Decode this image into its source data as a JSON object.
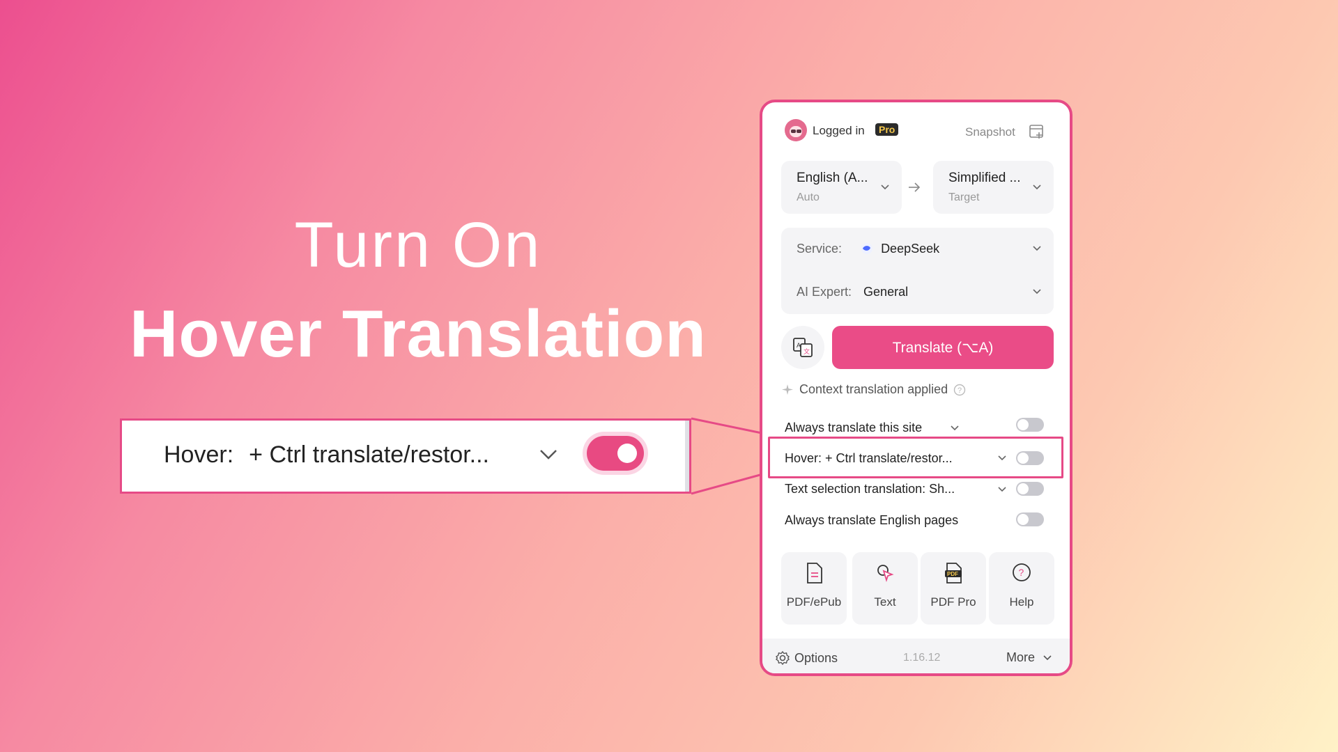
{
  "headline": {
    "line1": "Turn On",
    "line2": "Hover Translation"
  },
  "zoom": {
    "label": "Hover:",
    "value": "+ Ctrl translate/restor...",
    "toggle_on": true
  },
  "popup": {
    "login_text": "Logged in",
    "pro_badge": "Pro",
    "snapshot_label": "Snapshot",
    "source_lang": {
      "name": "English (A...",
      "sub": "Auto"
    },
    "target_lang": {
      "name": "Simplified ...",
      "sub": "Target"
    },
    "service": {
      "label": "Service:",
      "value": "DeepSeek"
    },
    "ai_expert": {
      "label": "AI Expert:",
      "value": "General"
    },
    "translate_button": "Translate (⌥A)",
    "context_text": "Context translation applied",
    "options": [
      {
        "label": "Always translate this site",
        "has_dropdown": true,
        "on": false
      },
      {
        "label": "Hover:  + Ctrl translate/restor...",
        "has_dropdown": true,
        "on": false
      },
      {
        "label": "Text selection translation:  Sh...",
        "has_dropdown": true,
        "on": false
      },
      {
        "label": "Always translate English pages",
        "has_dropdown": false,
        "on": false
      }
    ],
    "tiles": [
      {
        "label": "PDF/ePub",
        "icon": "document-icon"
      },
      {
        "label": "Text",
        "icon": "cursor-icon"
      },
      {
        "label": "PDF Pro",
        "icon": "pdf-pro-icon"
      },
      {
        "label": "Help",
        "icon": "help-icon"
      }
    ],
    "footer": {
      "options": "Options",
      "version": "1.16.12",
      "more": "More"
    }
  },
  "colors": {
    "accent": "#ea4c87",
    "toggle_off": "#c8c8ce",
    "panel_bg": "#f4f4f6"
  }
}
